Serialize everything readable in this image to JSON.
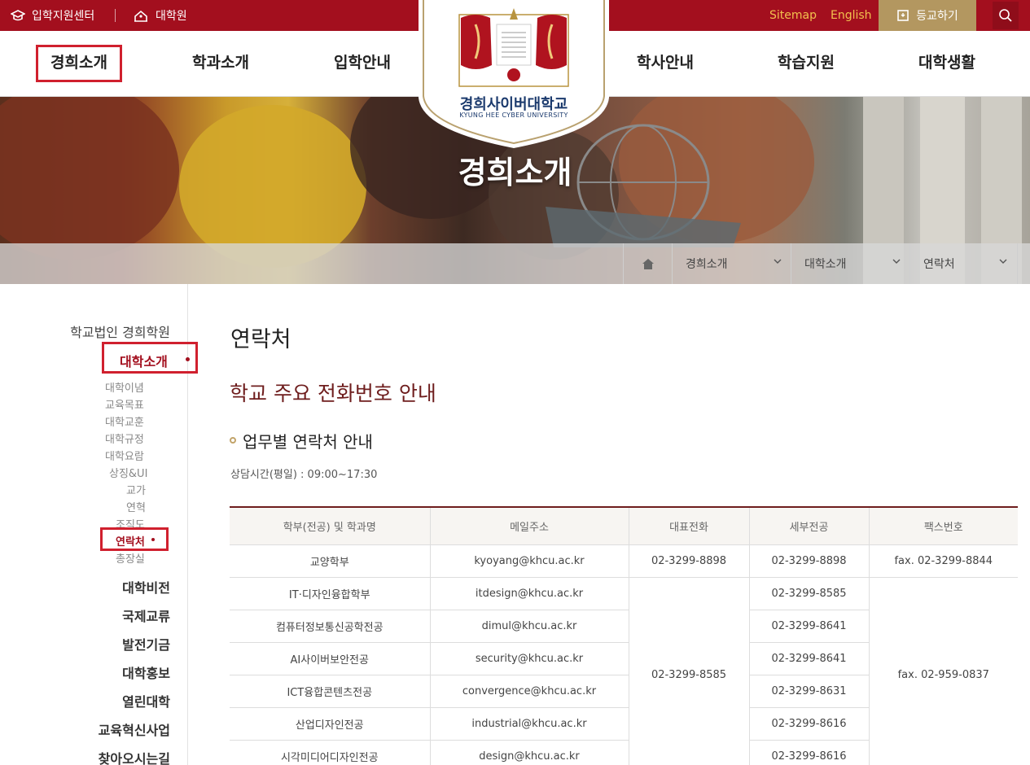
{
  "topbar": {
    "admissions_center": "입학지원센터",
    "graduate_school": "대학원",
    "sitemap": "Sitemap",
    "english": "English",
    "enroll": "등교하기"
  },
  "nav": {
    "items": [
      {
        "label": "경희소개"
      },
      {
        "label": "학과소개"
      },
      {
        "label": "입학안내"
      },
      {
        "label": "학사안내"
      },
      {
        "label": "학습지원"
      },
      {
        "label": "대학생활"
      }
    ]
  },
  "logo": {
    "name_ko": "경희사이버대학교",
    "name_en": "KYUNG HEE CYBER UNIVERSITY"
  },
  "hero": {
    "title": "경희소개"
  },
  "breadcrumb": {
    "level1": "경희소개",
    "level2": "대학소개",
    "level3": "연락처"
  },
  "sidebar": {
    "top": "학교법인 경희학원",
    "current": "대학소개",
    "subitems": [
      "대학이념",
      "교육목표",
      "대학교훈",
      "대학규정",
      "대학요람",
      "상징&UI",
      "교가",
      "연혁",
      "조직도",
      "연락처",
      "총장실"
    ],
    "sections": [
      "대학비전",
      "국제교류",
      "발전기금",
      "대학홍보",
      "열린대학",
      "교육혁신사업",
      "찾아오시는길"
    ]
  },
  "content": {
    "page_title": "연락처",
    "section_title": "학교 주요 전화번호 안내",
    "subsection_title": "업무별 연락처 안내",
    "hours": "상담시간(평일) : 09:00~17:30",
    "table": {
      "headers": [
        "학부(전공) 및 학과명",
        "메일주소",
        "대표전화",
        "세부전공",
        "팩스번호"
      ],
      "row0": {
        "dept": "교양학부",
        "email": "kyoyang@khcu.ac.kr",
        "main_phone": "02-3299-8898",
        "detail_phone": "02-3299-8898",
        "fax": "fax. 02-3299-8844"
      },
      "group_main_phone": "02-3299-8585",
      "group_fax": "fax. 02-959-0837",
      "rows": [
        {
          "dept": "IT·디자인융합학부",
          "email": "itdesign@khcu.ac.kr",
          "detail_phone": "02-3299-8585"
        },
        {
          "dept": "컴퓨터정보통신공학전공",
          "email": "dimul@khcu.ac.kr",
          "detail_phone": "02-3299-8641"
        },
        {
          "dept": "AI사이버보안전공",
          "email": "security@khcu.ac.kr",
          "detail_phone": "02-3299-8641"
        },
        {
          "dept": "ICT융합콘텐츠전공",
          "email": "convergence@khcu.ac.kr",
          "detail_phone": "02-3299-8631"
        },
        {
          "dept": "산업디자인전공",
          "email": "industrial@khcu.ac.kr",
          "detail_phone": "02-3299-8616"
        },
        {
          "dept": "시각미디어디자인전공",
          "email": "design@khcu.ac.kr",
          "detail_phone": "02-3299-8616"
        }
      ]
    }
  },
  "colors": {
    "brand_red": "#a30f1e",
    "gold": "#b39760",
    "heading_maroon": "#6e1d1d",
    "highlight_red": "#d0202e"
  }
}
